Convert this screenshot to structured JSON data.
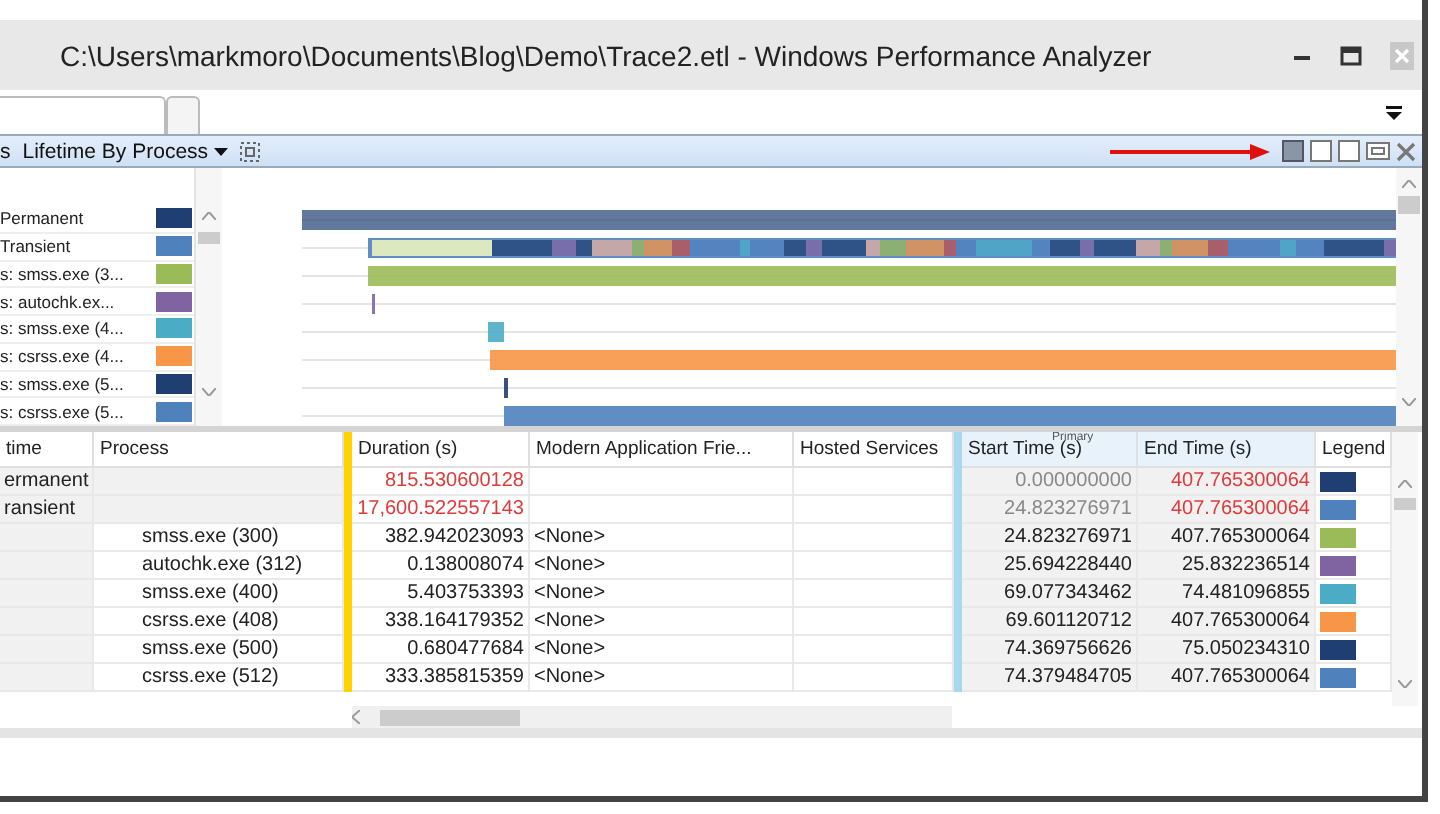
{
  "window": {
    "title": "C:\\Users\\markmoro\\Documents\\Blog\\Demo\\Trace2.etl - Windows Performance Analyzer"
  },
  "toolbar": {
    "cut_label": "s",
    "preset": "Lifetime By Process",
    "layout_buttons": [
      {
        "selected": true
      },
      {
        "selected": false
      },
      {
        "selected": false
      }
    ]
  },
  "timeline": {
    "rows": [
      {
        "label": "Permanent",
        "color": "#1f3f73"
      },
      {
        "label": "Transient",
        "color": "#4f81bd"
      },
      {
        "label": "s: smss.exe (3...",
        "color": "#9bbb59"
      },
      {
        "label": "s: autochk.ex...",
        "color": "#8064a2"
      },
      {
        "label": "s: smss.exe (4...",
        "color": "#4bacc6"
      },
      {
        "label": "s: csrss.exe (4...",
        "color": "#f79646"
      },
      {
        "label": "s: smss.exe (5...",
        "color": "#1f3f73"
      },
      {
        "label": "s: csrss.exe (5...",
        "color": "#4f81bd"
      }
    ]
  },
  "table": {
    "columns": [
      "time",
      "Process",
      "Duration (s)",
      "Modern Application Frie...",
      "Hosted Services",
      "Start Time (s)",
      "End Time (s)",
      "Legend"
    ],
    "sort_label": "Primary",
    "rows": [
      {
        "kind": "group",
        "time": "ermanent",
        "duration": "815.530600128",
        "start": "0.000000000",
        "end": "407.765300064",
        "color": "#1f3f73"
      },
      {
        "kind": "group",
        "time": "ransient",
        "duration": "17,600.522557143",
        "start": "24.823276971",
        "end": "407.765300064",
        "color": "#4f81bd"
      },
      {
        "kind": "process",
        "process": "smss.exe (300)",
        "duration": "382.942023093",
        "modern_app": "<None>",
        "start": "24.823276971",
        "end": "407.765300064",
        "color": "#9bbb59"
      },
      {
        "kind": "process",
        "process": "autochk.exe (312)",
        "duration": "0.138008074",
        "modern_app": "<None>",
        "start": "25.694228440",
        "end": "25.832236514",
        "color": "#8064a2"
      },
      {
        "kind": "process",
        "process": "smss.exe (400)",
        "duration": "5.403753393",
        "modern_app": "<None>",
        "start": "69.077343462",
        "end": "74.481096855",
        "color": "#4bacc6"
      },
      {
        "kind": "process",
        "process": "csrss.exe (408)",
        "duration": "338.164179352",
        "modern_app": "<None>",
        "start": "69.601120712",
        "end": "407.765300064",
        "color": "#f79646"
      },
      {
        "kind": "process",
        "process": "smss.exe (500)",
        "duration": "0.680477684",
        "modern_app": "<None>",
        "start": "74.369756626",
        "end": "75.050234310",
        "color": "#1f3f73"
      },
      {
        "kind": "process",
        "process": "csrss.exe (512)",
        "duration": "333.385815359",
        "modern_app": "<None>",
        "start": "74.379484705",
        "end": "407.765300064",
        "color": "#4f81bd"
      }
    ]
  }
}
